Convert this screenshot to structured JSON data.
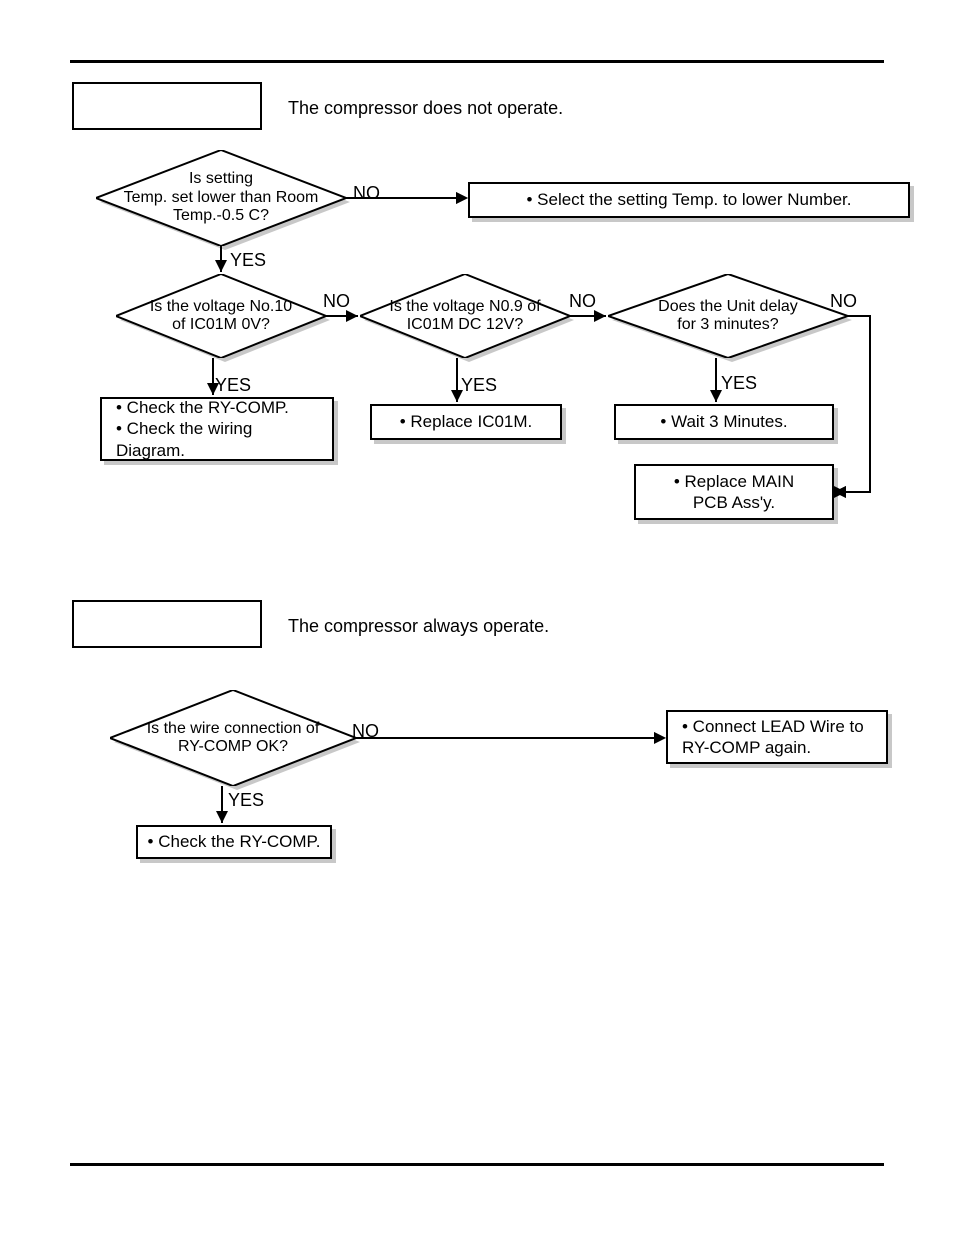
{
  "section1": {
    "symptom": "The compressor does not operate.",
    "d1": "Is setting\nTemp. set lower than Room\nTemp.-0.5 C?",
    "d2": "Is the voltage No.10\nof IC01M 0V?",
    "d3": "Is the voltage N0.9 of\nIC01M DC 12V?",
    "d4": "Does the Unit delay\nfor 3 minutes?",
    "p1": "• Select the setting Temp. to lower Number.",
    "p2": "• Check the RY-COMP.\n• Check the wiring\n  Diagram.",
    "p3": "• Replace IC01M.",
    "p4": "• Wait 3 Minutes.",
    "p5": "• Replace MAIN\nPCB Ass'y.",
    "yes": "YES",
    "no": "NO"
  },
  "section2": {
    "symptom": "The compressor always operate.",
    "d1": "Is the wire connection of\nRY-COMP OK?",
    "p1": "• Connect LEAD Wire to\n  RY-COMP again.",
    "p2": "• Check the RY-COMP.",
    "yes": "YES",
    "no": "NO"
  }
}
